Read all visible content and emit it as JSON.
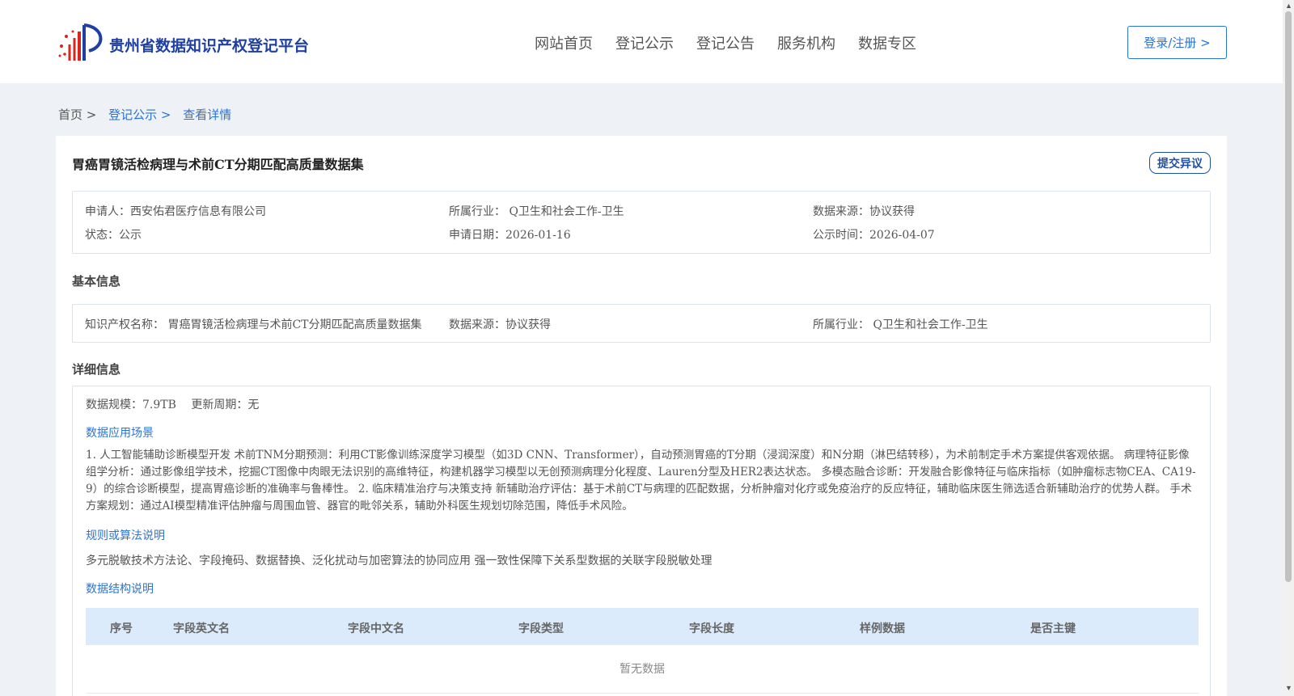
{
  "header": {
    "site_name": "贵州省数据知识产权登记平台",
    "nav": [
      "网站首页",
      "登记公示",
      "登记公告",
      "服务机构",
      "数据专区"
    ],
    "login_label": "登录/注册 >"
  },
  "breadcrumb": {
    "home": "首页 >",
    "level1": "登记公示 >",
    "current": "查看详情"
  },
  "detail": {
    "title": "胃癌胃镜活检病理与术前CT分期匹配高质量数据集",
    "objection_label": "提交异议",
    "meta": {
      "applicant": "申请人：西安佑君医疗信息有限公司",
      "industry": "所属行业： Q卫生和社会工作-卫生",
      "source": "数据来源：协议获得",
      "status": "状态：公示",
      "apply_date": "申请日期：2026-01-16",
      "publish_time": "公示时间：2026-04-07"
    },
    "basic_title": "基本信息",
    "basic": {
      "ip_name": "知识产权名称： 胃癌胃镜活检病理与术前CT分期匹配高质量数据集",
      "source": "数据来源：协议获得",
      "industry": "所属行业： Q卫生和社会工作-卫生"
    },
    "detail_title": "详细信息",
    "scale_line": "数据规模：7.9TB　 更新周期：无",
    "scenario_title": "数据应用场景",
    "scenario_text": "1. 人工智能辅助诊断模型开发 术前TNM分期预测：利用CT影像训练深度学习模型（如3D CNN、Transformer），自动预测胃癌的T分期（浸润深度）和N分期（淋巴结转移），为术前制定手术方案提供客观依据。 病理特征影像组学分析：通过影像组学技术，挖掘CT图像中肉眼无法识别的高维特征，构建机器学习模型以无创预测病理分化程度、Lauren分型及HER2表达状态。 多模态融合诊断：开发融合影像特征与临床指标（如肿瘤标志物CEA、CA19-9）的综合诊断模型，提高胃癌诊断的准确率与鲁棒性。 2. 临床精准治疗与决策支持 新辅助治疗评估：基于术前CT与病理的匹配数据，分析肿瘤对化疗或免疫治疗的反应特征，辅助临床医生筛选适合新辅助治疗的优势人群。 手术方案规划：通过AI模型精准评估肿瘤与周围血管、器官的毗邻关系，辅助外科医生规划切除范围，降低手术风险。",
    "rule_title": "规则或算法说明",
    "rule_text": "多元脱敏技术方法论、字段掩码、数据替换、泛化扰动与加密算法的协同应用 强一致性保障下关系型数据的关联字段脱敏处理",
    "structure_title": "数据结构说明",
    "table_headers": [
      "序号",
      "字段英文名",
      "字段中文名",
      "字段类型",
      "字段长度",
      "样例数据",
      "是否主键"
    ],
    "empty_text": "暂无数据"
  },
  "colors": {
    "brand": "#1f3fa3",
    "link": "#2a74d6",
    "table_header_bg": "#dcebfc",
    "page_bg": "#eef1f5"
  }
}
